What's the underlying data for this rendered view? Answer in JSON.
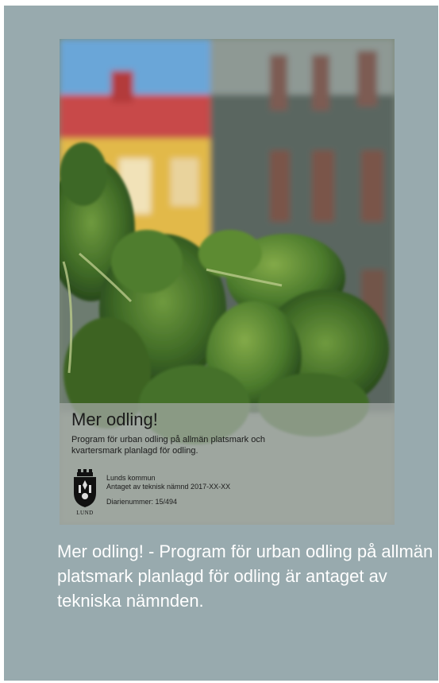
{
  "cover": {
    "title": "Mer odling!",
    "subtitle": "Program för urban odling på allmän platsmark och kvartersmark planlagd för odling.",
    "org": "Lunds kommun",
    "adopted": "Antaget av teknisk nämnd 2017-XX-XX",
    "diary": "Diarienummer: 15/494",
    "logo_label": "LUND"
  },
  "caption": "Mer odling! - Program för urban odling på allmän platsmark planlagd för odling är antaget av tekniska nämnden.",
  "colors": {
    "card_background": "#98aaae",
    "caption_text": "#ffffff"
  }
}
